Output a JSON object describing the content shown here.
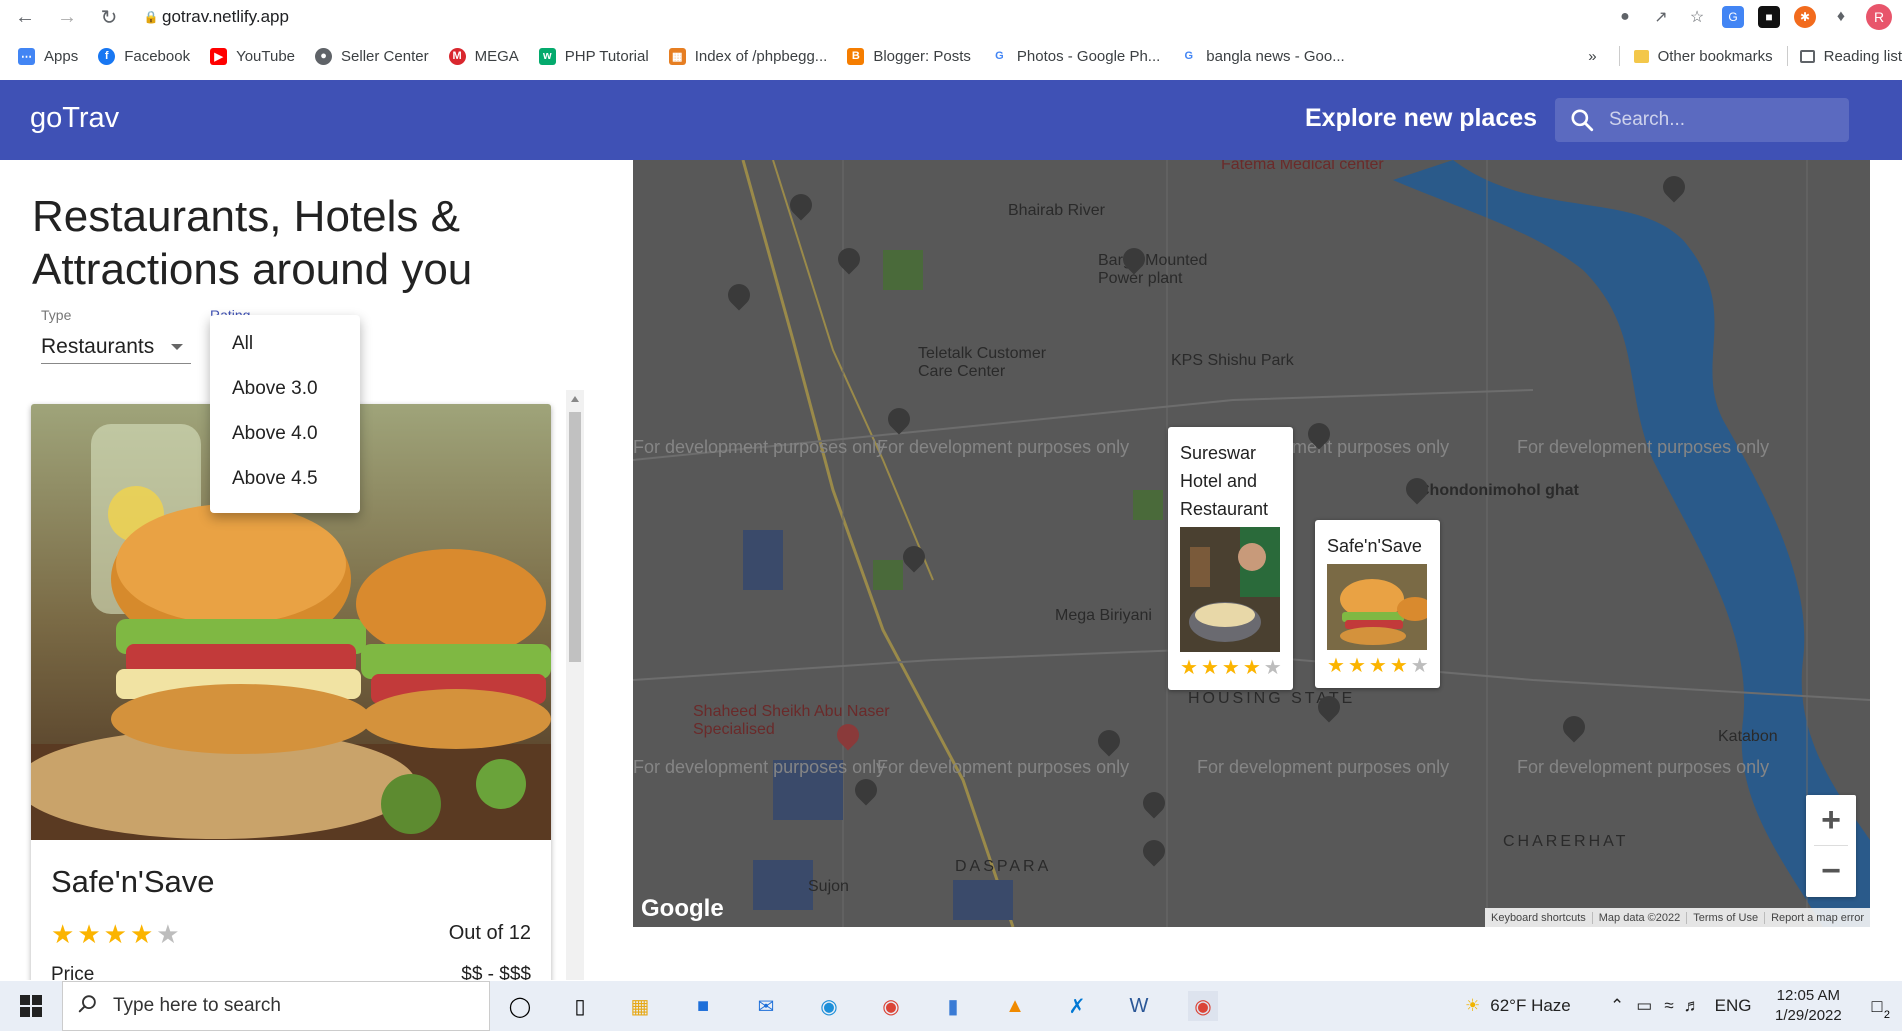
{
  "browser": {
    "url": "gotrav.netlify.app",
    "profile_initial": "R",
    "bookmarks": [
      {
        "label": "Apps",
        "icon": "apps-grid-icon",
        "color": "#4285f4"
      },
      {
        "label": "Facebook",
        "icon": "facebook-icon",
        "color": "#1877f2"
      },
      {
        "label": "YouTube",
        "icon": "youtube-icon",
        "color": "#ff0000"
      },
      {
        "label": "Seller Center",
        "icon": "globe-icon",
        "color": "#5f6368"
      },
      {
        "label": "MEGA",
        "icon": "mega-icon",
        "color": "#d9272e"
      },
      {
        "label": "PHP Tutorial",
        "icon": "w3schools-icon",
        "color": "#04aa6d"
      },
      {
        "label": "Index of /phpbegg...",
        "icon": "folder-icon",
        "color": "#e67e22"
      },
      {
        "label": "Blogger: Posts",
        "icon": "blogger-icon",
        "color": "#f57d00"
      },
      {
        "label": "Photos - Google Ph...",
        "icon": "google-icon",
        "color": "#4285f4"
      },
      {
        "label": "bangla news - Goo...",
        "icon": "google-icon",
        "color": "#4285f4"
      }
    ],
    "overflow": "»",
    "other_bookmarks": "Other bookmarks",
    "reading_list": "Reading list"
  },
  "app": {
    "brand": "goTrav",
    "explore": "Explore new places",
    "search_placeholder": "Search...",
    "theme_color": "#3f51b5"
  },
  "panel": {
    "heading": "Restaurants, Hotels & Attractions around you",
    "type_label": "Type",
    "type_value": "Restaurants",
    "rating_label": "Rating",
    "rating_options": [
      "All",
      "Above 3.0",
      "Above 4.0",
      "Above 4.5"
    ]
  },
  "card": {
    "name": "Safe'n'Save",
    "rating": 4,
    "rating_max": 5,
    "out_of": "Out of 12",
    "price_label": "Price",
    "price_value": "$$ - $$$"
  },
  "map": {
    "markers": [
      {
        "name": "Sureswar Hotel and Restaurant",
        "rating": 4
      },
      {
        "name": "Safe'n'Save",
        "rating": 4
      }
    ],
    "watermark": "For development purposes only",
    "labels": [
      "Bhairab River",
      "Barge Mounted Power plant",
      "Teletalk Customer Care Center",
      "KPS Shishu Park",
      "Chondonimohol ghat",
      "Mega Biriyani",
      "HOUSING STATE",
      "Shaheed Sheikh Abu Naser Specialised",
      "Katabon",
      "CHARERHAT",
      "DASPARA",
      "Sujon",
      "Fatema Medical center"
    ],
    "zoom_in": "+",
    "zoom_out": "−",
    "google": "Google",
    "attribution": [
      "Keyboard shortcuts",
      "Map data ©2022",
      "Terms of Use",
      "Report a map error"
    ]
  },
  "taskbar": {
    "search_placeholder": "Type here to search",
    "weather": "62°F Haze",
    "lang": "ENG",
    "time": "12:05 AM",
    "date": "1/29/2022",
    "notification_count": "2"
  },
  "colors": {
    "star_filled": "#fbb400",
    "star_empty": "#bdbdbd"
  }
}
